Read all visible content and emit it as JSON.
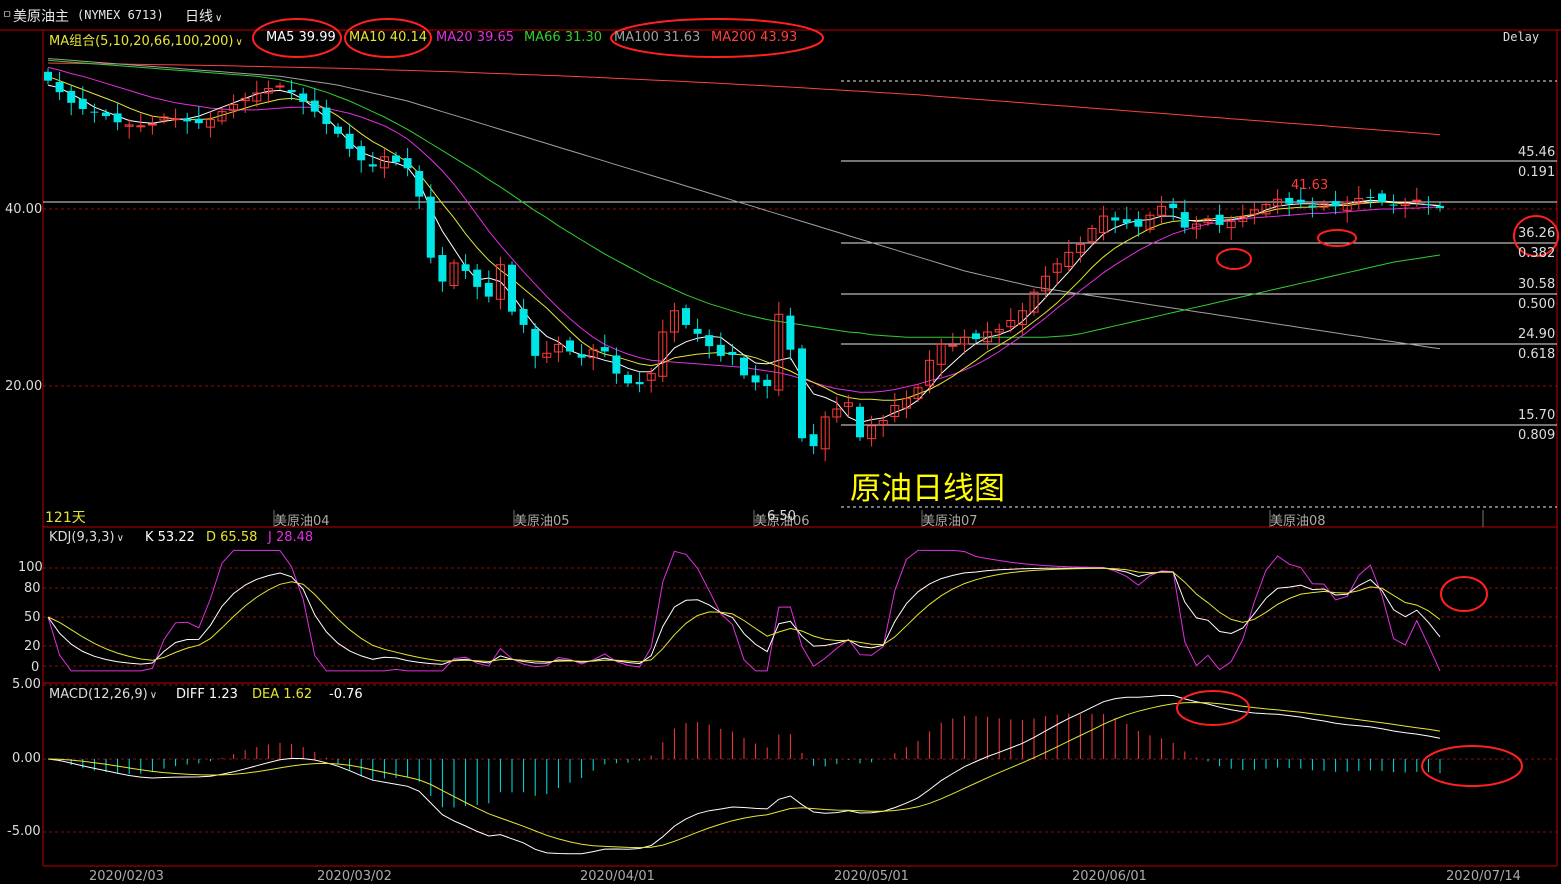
{
  "header": {
    "symbol": "美原油主",
    "code": "(NYMEX 6713)",
    "period": "日线",
    "delay": "Delay"
  },
  "ma": {
    "group_label": "MA组合(5,10,20,66,100,200)",
    "items": [
      {
        "name": "MA5",
        "value": "39.99",
        "color": "#ffffff"
      },
      {
        "name": "MA10",
        "value": "40.14",
        "color": "#e6e632"
      },
      {
        "name": "MA20",
        "value": "39.65",
        "color": "#e030e0"
      },
      {
        "name": "MA66",
        "value": "31.30",
        "color": "#30d030"
      },
      {
        "name": "MA100",
        "value": "31.63",
        "color": "#a0a0a0"
      },
      {
        "name": "MA200",
        "value": "43.93",
        "color": "#ff4040"
      }
    ]
  },
  "price_axis": {
    "labels": [
      "40.00",
      "20.00"
    ]
  },
  "day_count": "121天",
  "month_markers": [
    "美原油04",
    "美原油05",
    "美原油06",
    "美原油07",
    "美原油08"
  ],
  "low_label": "6.50",
  "high_label": "41.63",
  "caption": "原油日线图",
  "fibonacci": [
    {
      "price": "45.46",
      "ratio": "0.191"
    },
    {
      "price": "36.26",
      "ratio": "0.382"
    },
    {
      "price": "30.58",
      "ratio": "0.500"
    },
    {
      "price": "24.90",
      "ratio": "0.618"
    },
    {
      "price": "15.70",
      "ratio": "0.809"
    }
  ],
  "kdj": {
    "label": "KDJ(9,3,3)",
    "k": "K 53.22",
    "d": "D 65.58",
    "j": "J 28.48",
    "axis": [
      "100",
      "80",
      "50",
      "20",
      "0"
    ]
  },
  "macd": {
    "label": "MACD(12,26,9)",
    "diff": "DIFF 1.23",
    "dea": "DEA 1.62",
    "hist": "-0.76",
    "axis": [
      "5.00",
      "0.00",
      "-5.00"
    ]
  },
  "dates": [
    "2020/02/03",
    "2020/03/02",
    "2020/04/01",
    "2020/05/01",
    "2020/06/01",
    "2020/07/14"
  ],
  "colors": {
    "up": "#ff3b3b",
    "down": "#00e5e5",
    "ma5": "#ffffff",
    "ma10": "#e6e632",
    "ma20": "#e030e0",
    "ma66": "#30d030",
    "ma100": "#a0a0a0",
    "ma200": "#ff4040",
    "annotation": "#ff2020"
  },
  "chart_data": {
    "type": "candlestick",
    "ylim": [
      5,
      56
    ],
    "closes": [
      54.5,
      53.2,
      52.0,
      51.3,
      50.9,
      50.5,
      49.8,
      49.5,
      49.4,
      49.6,
      50.4,
      50.2,
      49.9,
      49.7,
      50.1,
      51.0,
      51.8,
      52.5,
      53.1,
      53.6,
      53.9,
      53.2,
      52.1,
      51.0,
      49.6,
      48.5,
      46.8,
      45.5,
      44.8,
      45.9,
      45.3,
      44.6,
      41.4,
      34.5,
      31.8,
      33.9,
      33.0,
      31.2,
      30.1,
      33.7,
      28.4,
      26.9,
      23.4,
      23.7,
      24.7,
      23.9,
      23.2,
      24.1,
      23.9,
      21.4,
      20.3,
      20.2,
      21.4,
      26.1,
      28.5,
      26.9,
      25.9,
      24.5,
      23.4,
      23.5,
      21.2,
      20.4,
      20.0,
      28.1,
      24.1,
      14.1,
      13.2,
      16.5,
      17.4,
      18.1,
      14.2,
      15.5,
      16.1,
      17.8,
      18.6,
      19.8,
      22.9,
      24.7,
      24.6,
      25.5,
      25.3,
      26.1,
      26.4,
      27.4,
      28.5,
      30.6,
      32.4,
      33.8,
      35.1,
      36.0,
      37.8,
      39.2,
      38.7,
      38.4,
      38.0,
      39.3,
      40.3,
      40.1,
      37.9,
      38.3,
      38.9,
      38.2,
      38.6,
      39.1,
      39.9,
      40.5,
      41.1,
      40.6,
      40.7,
      40.2,
      40.6,
      40.3,
      40.8,
      41.2,
      41.3,
      40.8,
      40.4,
      40.6,
      41.0,
      40.5,
      40.1
    ],
    "ma5": [
      54,
      53.7,
      53,
      52.3,
      51.5,
      51,
      50.5,
      50,
      49.8,
      49.7,
      49.9,
      50.1,
      50.2,
      50.5,
      51,
      51.5,
      52,
      52.5,
      53,
      53.3,
      53.4,
      53.1,
      52.4,
      51.4,
      50.3,
      49,
      47.6,
      46.4,
      45.9,
      45.4,
      45.2,
      44.7,
      43,
      40,
      37.5,
      35.5,
      33.5,
      32,
      32.2,
      31.8,
      30.3,
      28.5,
      26.8,
      25.6,
      25,
      24,
      23.5,
      23.3,
      22.9,
      22.6,
      22,
      21.6,
      21.6,
      22.8,
      24.3,
      25,
      25.4,
      25.6,
      25.5,
      24.5,
      23.5,
      22.6,
      22.5,
      22.9,
      23.2,
      21,
      19.1,
      18.7,
      18.1,
      16.5,
      15.9,
      16.2,
      16.4,
      17,
      17.5,
      18.4,
      19.8,
      21.4,
      22.6,
      23.8,
      24.8,
      25.5,
      25.8,
      26.3,
      27.3,
      28.6,
      30,
      31.5,
      32.9,
      34.5,
      35.9,
      37.2,
      37.9,
      38.4,
      38.7,
      38.8,
      39.2,
      39.2,
      38.8,
      38.6,
      38.7,
      38.7,
      38.8,
      39,
      39.3,
      39.9,
      40.3,
      40.5,
      40.6,
      40.6,
      40.5,
      40.5,
      40.6,
      40.8,
      41,
      40.9,
      40.8,
      40.7,
      40.6,
      40.5,
      40.3
    ],
    "ma10": [
      55,
      54.5,
      54,
      53.5,
      53,
      52.5,
      52,
      51.4,
      50.9,
      50.5,
      50.3,
      50.2,
      50.1,
      50.1,
      50.2,
      50.6,
      51,
      51.4,
      51.8,
      52.1,
      52.4,
      52.5,
      52.3,
      51.9,
      51.3,
      50.5,
      49.5,
      48.5,
      47.6,
      46.9,
      46.1,
      45.3,
      44,
      42.3,
      40.6,
      39,
      37.2,
      35.6,
      34.2,
      33.1,
      32.1,
      31,
      29.9,
      28.8,
      27.5,
      26.2,
      25,
      24.1,
      23.6,
      23.3,
      22.9,
      22.5,
      22.3,
      22.6,
      23.2,
      23.4,
      23.6,
      23.7,
      23.8,
      23.6,
      23.5,
      23.2,
      22.7,
      22.2,
      21.7,
      21,
      20.4,
      19.8,
      19.1,
      18.7,
      18.5,
      18.5,
      18.4,
      18.4,
      18.6,
      19.1,
      19.6,
      20.3,
      21.1,
      22,
      22.9,
      23.9,
      24.6,
      25.4,
      26.3,
      27.3,
      28.3,
      29.4,
      30.7,
      32,
      33.4,
      34.6,
      35.6,
      36.4,
      37.1,
      37.8,
      38.3,
      38.6,
      38.7,
      38.7,
      38.8,
      39,
      39,
      39.2,
      39.4,
      39.7,
      40,
      40.1,
      40.2,
      40.2,
      40.3,
      40.4,
      40.4,
      40.6,
      40.7,
      40.8,
      40.7,
      40.6,
      40.6,
      40.5,
      40.4
    ],
    "ma20": [
      56,
      55.7,
      55.3,
      55,
      54.6,
      54.2,
      53.8,
      53.4,
      53,
      52.6,
      52.3,
      52,
      51.8,
      51.6,
      51.4,
      51.3,
      51.2,
      51.2,
      51.2,
      51.3,
      51.4,
      51.5,
      51.5,
      51.5,
      51.4,
      51.1,
      50.8,
      50.4,
      49.9,
      49.4,
      48.7,
      47.9,
      46.8,
      45.6,
      44.3,
      42.8,
      41.1,
      39.3,
      37.5,
      35.9,
      34.4,
      32.9,
      31.5,
      30.1,
      28.8,
      27.6,
      26.5,
      25.5,
      24.7,
      24.1,
      23.6,
      23.2,
      22.9,
      22.8,
      22.7,
      22.6,
      22.5,
      22.4,
      22.3,
      22.2,
      22.1,
      21.9,
      21.7,
      21.5,
      21.2,
      20.8,
      20.4,
      20,
      19.7,
      19.5,
      19.3,
      19.3,
      19.4,
      19.6,
      19.9,
      20.2,
      20.6,
      20.9,
      21.3,
      21.8,
      22.4,
      23.1,
      23.9,
      24.8,
      25.7,
      26.7,
      27.7,
      28.8,
      29.8,
      30.8,
      31.8,
      32.8,
      33.7,
      34.5,
      35.3,
      36,
      36.6,
      37.2,
      37.6,
      38,
      38.3,
      38.5,
      38.7,
      38.9,
      39,
      39.1,
      39.2,
      39.3,
      39.4,
      39.5,
      39.5,
      39.6,
      39.7,
      39.8,
      39.9,
      40,
      40,
      40.1,
      40.1,
      40.2,
      40.2
    ],
    "ma66": [
      56.8,
      56.7,
      56.6,
      56.5,
      56.4,
      56.3,
      56.2,
      56.1,
      56,
      55.9,
      55.8,
      55.7,
      55.6,
      55.5,
      55.4,
      55.3,
      55.2,
      55.1,
      55,
      54.8,
      54.6,
      54.3,
      54,
      53.6,
      53.2,
      52.7,
      52.2,
      51.6,
      51,
      50.4,
      49.7,
      49,
      48.2,
      47.4,
      46.6,
      45.8,
      45,
      44.2,
      43.3,
      42.5,
      41.6,
      40.7,
      39.8,
      39,
      38.1,
      37.3,
      36.5,
      35.7,
      34.9,
      34.2,
      33.5,
      32.8,
      32.1,
      31.5,
      30.9,
      30.3,
      29.8,
      29.3,
      28.9,
      28.5,
      28.1,
      27.8,
      27.5,
      27.3,
      27.1,
      26.9,
      26.7,
      26.5,
      26.3,
      26.1,
      26,
      25.8,
      25.7,
      25.6,
      25.5,
      25.5,
      25.5,
      25.5,
      25.5,
      25.5,
      25.5,
      25.5,
      25.5,
      25.5,
      25.5,
      25.5,
      25.5,
      25.6,
      25.7,
      25.9,
      26.2,
      26.5,
      26.8,
      27.1,
      27.4,
      27.7,
      28,
      28.3,
      28.6,
      28.9,
      29.2,
      29.5,
      29.8,
      30.1,
      30.4,
      30.7,
      31,
      31.3,
      31.6,
      31.9,
      32.2,
      32.5,
      32.8,
      33.1,
      33.4,
      33.7,
      34,
      34.2,
      34.4,
      34.6,
      34.8
    ],
    "ma100": [
      57,
      56.9,
      56.8,
      56.7,
      56.6,
      56.5,
      56.4,
      56.3,
      56.2,
      56.1,
      56,
      55.9,
      55.8,
      55.7,
      55.6,
      55.5,
      55.4,
      55.3,
      55.2,
      55.1,
      55,
      54.8,
      54.6,
      54.4,
      54.2,
      54,
      53.7,
      53.4,
      53.1,
      52.8,
      52.5,
      52.2,
      51.8,
      51.4,
      51,
      50.6,
      50.2,
      49.8,
      49.4,
      49,
      48.6,
      48.2,
      47.8,
      47.4,
      47,
      46.6,
      46.2,
      45.8,
      45.4,
      45,
      44.6,
      44.2,
      43.8,
      43.4,
      43,
      42.6,
      42.2,
      41.8,
      41.4,
      41,
      40.6,
      40.2,
      39.8,
      39.4,
      39,
      38.6,
      38.2,
      37.8,
      37.4,
      37,
      36.6,
      36.2,
      35.8,
      35.4,
      35,
      34.6,
      34.2,
      33.8,
      33.4,
      33,
      32.7,
      32.4,
      32.1,
      31.8,
      31.5,
      31.2,
      31,
      30.8,
      30.6,
      30.4,
      30.2,
      30,
      29.8,
      29.6,
      29.4,
      29.2,
      29,
      28.8,
      28.6,
      28.4,
      28.2,
      28,
      27.8,
      27.6,
      27.4,
      27.2,
      27,
      26.8,
      26.6,
      26.4,
      26.2,
      26,
      25.8,
      25.6,
      25.4,
      25.2,
      25,
      24.8,
      24.6,
      24.4,
      24.2
    ],
    "ma200": [
      56.5,
      56.48,
      56.46,
      56.44,
      56.42,
      56.4,
      56.38,
      56.36,
      56.34,
      56.32,
      56.3,
      56.28,
      56.26,
      56.24,
      56.22,
      56.2,
      56.17,
      56.14,
      56.11,
      56.08,
      56.05,
      56.02,
      55.99,
      55.96,
      55.93,
      55.9,
      55.86,
      55.82,
      55.78,
      55.74,
      55.7,
      55.66,
      55.62,
      55.58,
      55.54,
      55.5,
      55.45,
      55.4,
      55.35,
      55.3,
      55.25,
      55.2,
      55.15,
      55.1,
      55.05,
      55,
      54.94,
      54.88,
      54.82,
      54.76,
      54.7,
      54.64,
      54.58,
      54.52,
      54.46,
      54.4,
      54.33,
      54.26,
      54.19,
      54.12,
      54.05,
      53.98,
      53.91,
      53.84,
      53.77,
      53.7,
      53.62,
      53.54,
      53.46,
      53.38,
      53.3,
      53.22,
      53.14,
      53.06,
      52.98,
      52.9,
      52.8,
      52.7,
      52.6,
      52.5,
      52.4,
      52.3,
      52.2,
      52.1,
      52,
      51.9,
      51.8,
      51.7,
      51.6,
      51.5,
      51.4,
      51.3,
      51.2,
      51.1,
      51,
      50.9,
      50.8,
      50.7,
      50.6,
      50.5,
      50.4,
      50.3,
      50.2,
      50.1,
      50,
      49.9,
      49.8,
      49.7,
      49.6,
      49.5,
      49.4,
      49.3,
      49.2,
      49.1,
      49,
      48.9,
      48.8,
      48.7,
      48.6,
      48.5,
      48.4
    ]
  }
}
